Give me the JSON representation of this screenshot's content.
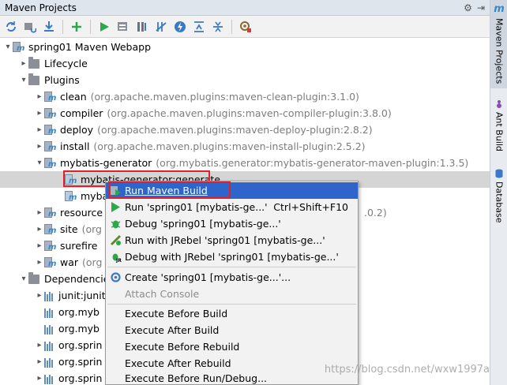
{
  "window": {
    "title": "Maven Projects",
    "controls": [
      "⚙",
      "⇥"
    ]
  },
  "toolbar": {
    "buttons": [
      "refresh-icon",
      "generate-sources-icon",
      "download-icon",
      "add-icon",
      "run-icon",
      "run-configuration-icon",
      "toggle-offline-icon",
      "skip-tests-icon",
      "lightning-icon",
      "collapse-all-icon",
      "expand-all-icon",
      "settings-icon"
    ]
  },
  "sidebar": {
    "tabs": [
      {
        "label": "Maven Projects",
        "icon": "m"
      },
      {
        "label": "Ant Build",
        "icon": "ant-icon"
      },
      {
        "label": "Database",
        "icon": "database-icon"
      }
    ]
  },
  "tree": {
    "root": "spring01 Maven Webapp",
    "lifecycle": "Lifecycle",
    "plugins": "Plugins",
    "plugin_items": [
      {
        "name": "clean",
        "coord": "(org.apache.maven.plugins:maven-clean-plugin:3.1.0)"
      },
      {
        "name": "compiler",
        "coord": "(org.apache.maven.plugins:maven-compiler-plugin:3.8.0)"
      },
      {
        "name": "deploy",
        "coord": "(org.apache.maven.plugins:maven-deploy-plugin:2.8.2)"
      },
      {
        "name": "install",
        "coord": "(org.apache.maven.plugins:maven-install-plugin:2.5.2)"
      },
      {
        "name": "mybatis-generator",
        "coord": "(org.mybatis.generator:mybatis-generator-maven-plugin:1.3.5)"
      }
    ],
    "goal_selected": "mybatis-generator:generate",
    "goal_2": "myba",
    "plugin_more": [
      {
        "name": "resource",
        "coord": ".0.2)"
      },
      {
        "name": "site",
        "coord": "(org"
      },
      {
        "name": "surefire",
        "coord": ""
      },
      {
        "name": "war",
        "coord": "(org"
      }
    ],
    "dependencies": "Dependencies",
    "deps": [
      "junit:junit",
      "org.myb",
      "org.myb",
      "org.sprin",
      "org.sprin",
      "org.sprin"
    ]
  },
  "menu": {
    "items": [
      {
        "label": "Run Maven Build",
        "shortcut": "",
        "icon": "maven-run-icon"
      },
      {
        "label": "Run 'spring01 [mybatis-ge...'",
        "shortcut": "Ctrl+Shift+F10",
        "icon": "run-icon"
      },
      {
        "label": "Debug 'spring01 [mybatis-ge...'",
        "shortcut": "",
        "icon": "debug-icon"
      },
      {
        "label": "Run with JRebel 'spring01 [mybatis-ge...'",
        "shortcut": "",
        "icon": "jrebel-run-icon"
      },
      {
        "label": "Debug with JRebel 'spring01 [mybatis-ge...'",
        "shortcut": "",
        "icon": "jrebel-debug-icon"
      },
      {
        "label": "Create 'spring01 [mybatis-ge...'...",
        "shortcut": "",
        "icon": "create-config-icon"
      },
      {
        "label": "Attach Console",
        "shortcut": "",
        "icon": ""
      },
      {
        "label": "Execute Before Build",
        "shortcut": "",
        "icon": ""
      },
      {
        "label": "Execute After Build",
        "shortcut": "",
        "icon": ""
      },
      {
        "label": "Execute Before Rebuild",
        "shortcut": "",
        "icon": ""
      },
      {
        "label": "Execute After Rebuild",
        "shortcut": "",
        "icon": ""
      },
      {
        "label": "Execute Before Run/Debug...",
        "shortcut": "",
        "icon": ""
      }
    ]
  },
  "watermark": "https://blog.csdn.net/wxw1997a",
  "colors": {
    "highlight": "#2f65ca",
    "annotation": "#e0202a",
    "run_green": "#2aa84a"
  }
}
